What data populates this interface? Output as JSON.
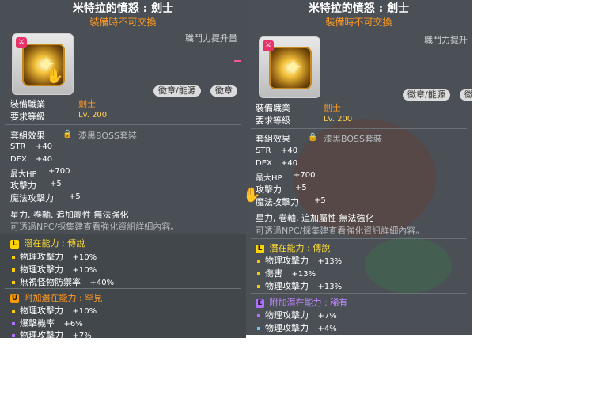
{
  "left": {
    "title": "米特拉的憤怒 : 劍士",
    "subtitle": "裝備時不可交換",
    "damage_label": "職鬥力提升量",
    "pills": [
      "徽章/能源",
      "徽章"
    ],
    "job_label": "裝備職業",
    "job_value": "劍士",
    "level_label": "要求等級",
    "level_value": "Lv. 200",
    "set_label": "套組效果",
    "set_value": "漆黑BOSS套裝",
    "stats": [
      {
        "name": "STR",
        "value": "+40"
      },
      {
        "name": "DEX",
        "value": "+40"
      },
      {
        "name": "最大HP",
        "value": "+700"
      },
      {
        "name": "攻擊力",
        "value": "+5"
      },
      {
        "name": "魔法攻擊力",
        "value": "+5"
      }
    ],
    "enhance_line": "星力, 卷軸, 追加屬性 無法強化",
    "npc_line": "可透過NPC/採集建查看強化資訊詳細內容。",
    "potential": {
      "letter": "L",
      "label": "潛在能力 : 傳說",
      "lines": [
        {
          "name": "物理攻擊力",
          "value": "+10%"
        },
        {
          "name": "物理攻擊力",
          "value": "+10%"
        },
        {
          "name": "無視怪物防禦率",
          "value": "+40%"
        }
      ]
    },
    "bonus": {
      "letter": "U",
      "label": "附加潛在能力 : 罕見",
      "lines": [
        {
          "name": "物理攻擊力",
          "value": "+10%"
        },
        {
          "name": "爆擊機率",
          "value": "+6%"
        },
        {
          "name": "物理攻擊力",
          "value": "+7%"
        }
      ]
    }
  },
  "right": {
    "title": "米特拉的憤怒 : 劍士",
    "subtitle": "裝備時不可交換",
    "damage_label": "職鬥力提升",
    "pills": [
      "徽章/能源",
      "徽"
    ],
    "job_label": "裝備職業",
    "job_value": "劍士",
    "level_label": "要求等級",
    "level_value": "Lv. 200",
    "set_label": "套組效果",
    "set_value": "漆黑BOSS套裝",
    "stats": [
      {
        "name": "STR",
        "value": "+40"
      },
      {
        "name": "DEX",
        "value": "+40"
      },
      {
        "name": "最大HP",
        "value": "+700"
      },
      {
        "name": "攻擊力",
        "value": "+5"
      },
      {
        "name": "魔法攻擊力",
        "value": "+5"
      }
    ],
    "enhance_line": "星力, 卷軸, 追加屬性 無法強化",
    "npc_line": "可透過NPC/採集建查看強化資訊詳細內容。",
    "potential": {
      "letter": "L",
      "label": "潛在能力 : 傳說",
      "lines": [
        {
          "name": "物理攻擊力",
          "value": "+13%"
        },
        {
          "name": "傷害",
          "value": "+13%"
        },
        {
          "name": "物理攻擊力",
          "value": "+13%"
        }
      ]
    },
    "bonus": {
      "letter": "E",
      "label": "附加潛在能力 : 稀有",
      "lines": [
        {
          "name": "物理攻擊力",
          "value": "+7%"
        },
        {
          "name": "物理攻擊力",
          "value": "+4%"
        }
      ]
    }
  },
  "colors": {
    "panel": "#4a4f55",
    "job": "#ff9922",
    "legend": "#ffdd33",
    "epic": "#c088ff"
  },
  "icons": [
    "emblem-icon",
    "hand-cursor-icon",
    "lock-icon",
    "potential-grade-icon"
  ]
}
